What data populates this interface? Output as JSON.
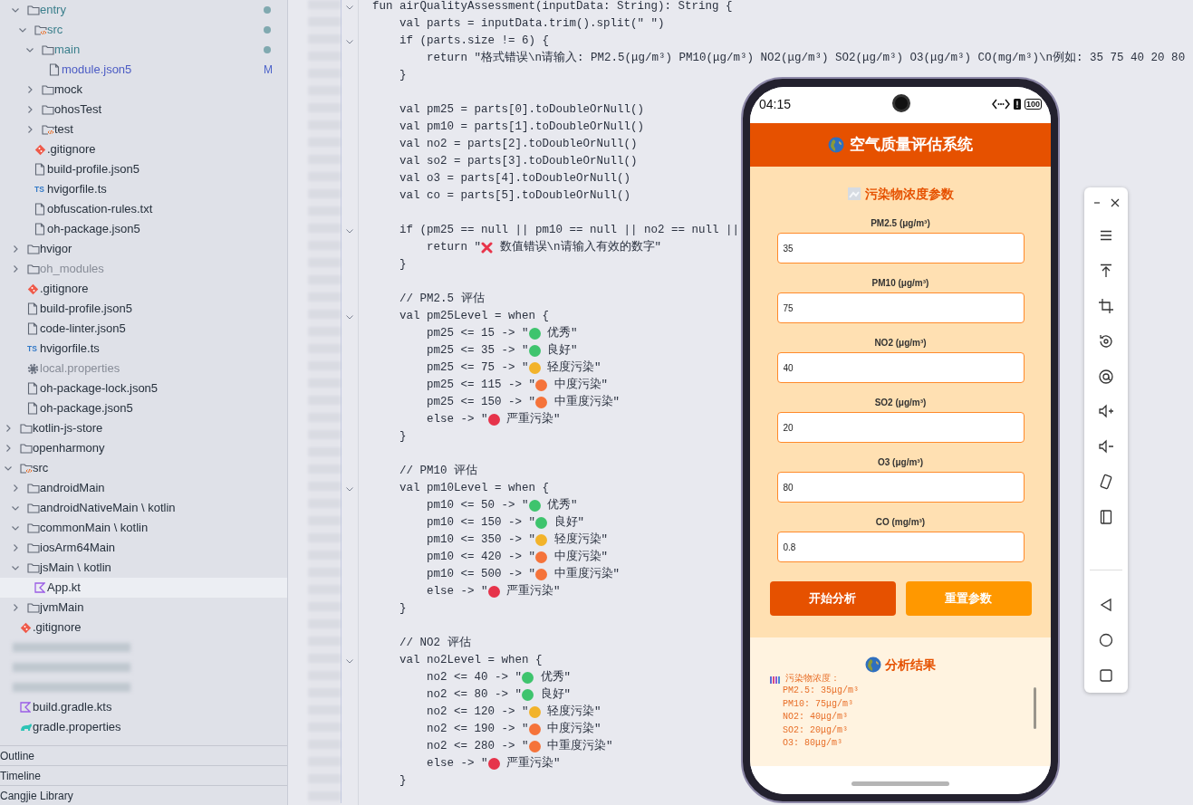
{
  "sidebar": {
    "tree": [
      {
        "children": [
          {
            "label": "entry",
            "kind": "folder",
            "expanded": true,
            "selected": false,
            "color": "#3b7f8c",
            "changed": true,
            "children": [
              {
                "label": "src",
                "kind": "source-folder",
                "expanded": true,
                "selected": false,
                "color": "#3b7f8c",
                "changed": true,
                "children": [
                  {
                    "label": "main",
                    "kind": "folder",
                    "expanded": true,
                    "selected": false,
                    "color": "#3b7f8c",
                    "changed": true,
                    "children": [
                      {
                        "label": "module.json5",
                        "kind": "file",
                        "selected": false,
                        "color": "#4b5bc4",
                        "badge": "M"
                      }
                    ]
                  },
                  {
                    "label": "mock",
                    "kind": "folder",
                    "expanded": false,
                    "selected": false
                  },
                  {
                    "label": "ohosTest",
                    "kind": "folder",
                    "expanded": false,
                    "selected": false
                  },
                  {
                    "label": "test",
                    "kind": "source-folder",
                    "expanded": false,
                    "selected": false
                  }
                ]
              },
              {
                "label": ".gitignore",
                "kind": "git",
                "selected": false
              },
              {
                "label": "build-profile.json5",
                "kind": "file",
                "selected": false
              },
              {
                "label": "hvigorfile.ts",
                "kind": "typescript",
                "icon_text": "TS",
                "selected": false
              },
              {
                "label": "obfuscation-rules.txt",
                "kind": "file",
                "selected": false
              },
              {
                "label": "oh-package.json5",
                "kind": "file",
                "selected": false
              }
            ]
          },
          {
            "label": "hvigor",
            "kind": "folder",
            "expanded": false,
            "selected": false
          },
          {
            "label": "oh_modules",
            "kind": "folder",
            "expanded": false,
            "selected": false,
            "color": "#878c97"
          },
          {
            "label": ".gitignore",
            "kind": "git",
            "selected": false
          },
          {
            "label": "build-profile.json5",
            "kind": "file",
            "selected": false
          },
          {
            "label": "code-linter.json5",
            "kind": "file",
            "selected": false
          },
          {
            "label": "hvigorfile.ts",
            "kind": "typescript",
            "icon_text": "TS",
            "selected": false
          },
          {
            "label": "local.properties",
            "kind": "gear",
            "selected": false,
            "color": "#878c97"
          },
          {
            "label": "oh-package-lock.json5",
            "kind": "file",
            "selected": false
          },
          {
            "label": "oh-package.json5",
            "kind": "file",
            "selected": false
          }
        ]
      },
      {
        "label": "kotlin-js-store",
        "kind": "folder",
        "expanded": false,
        "selected": false
      },
      {
        "label": "openharmony",
        "kind": "folder",
        "expanded": false,
        "selected": false
      },
      {
        "label": "src",
        "kind": "source-folder",
        "expanded": true,
        "selected": false,
        "children": [
          {
            "label": "androidMain",
            "kind": "folder",
            "expanded": false,
            "selected": false
          },
          {
            "label": "androidNativeMain \\ kotlin",
            "kind": "folder",
            "expanded": true,
            "selected": false
          },
          {
            "label": "commonMain \\ kotlin",
            "kind": "folder",
            "expanded": true,
            "selected": false
          },
          {
            "label": "iosArm64Main",
            "kind": "folder",
            "expanded": false,
            "selected": false
          },
          {
            "label": "jsMain \\ kotlin",
            "kind": "folder",
            "expanded": true,
            "selected": false,
            "children": [
              {
                "label": "App.kt",
                "kind": "kotlin",
                "selected": true
              }
            ]
          },
          {
            "label": "jvmMain",
            "kind": "folder",
            "expanded": false,
            "selected": false
          }
        ]
      },
      {
        "label": ".gitignore",
        "kind": "git",
        "selected": false
      },
      {
        "kind": "blurred"
      },
      {
        "kind": "blurred"
      },
      {
        "kind": "blurred"
      },
      {
        "label": "build.gradle.kts",
        "kind": "kotlin",
        "selected": false
      },
      {
        "label": "gradle.properties",
        "kind": "gradle",
        "selected": false
      }
    ],
    "panels": [
      "Outline",
      "Timeline",
      "Cangjie Library"
    ]
  },
  "code": {
    "lines": [
      {
        "kind": "code",
        "fold": true,
        "text": "fun airQualityAssessment(inputData: String): String {"
      },
      {
        "kind": "code",
        "fold": false,
        "text": "    val parts = inputData.trim().split(\" \")"
      },
      {
        "kind": "code",
        "fold": true,
        "text": "    if (parts.size != 6) {"
      },
      {
        "kind": "code",
        "fold": false,
        "text": "        return \"格式错误\\n请输入: PM2.5(μg/m³) PM10(μg/m³) NO2(μg/m³) SO2(μg/m³) O3(μg/m³) CO(mg/m³)\\n例如: 35 75 40 20 80"
      },
      {
        "kind": "code",
        "fold": false,
        "text": "    }"
      },
      {
        "kind": "blank"
      },
      {
        "kind": "code",
        "fold": false,
        "text": "    val pm25 = parts[0].toDoubleOrNull()"
      },
      {
        "kind": "code",
        "fold": false,
        "text": "    val pm10 = parts[1].toDoubleOrNull()"
      },
      {
        "kind": "code",
        "fold": false,
        "text": "    val no2 = parts[2].toDoubleOrNull()"
      },
      {
        "kind": "code",
        "fold": false,
        "text": "    val so2 = parts[3].toDoubleOrNull()"
      },
      {
        "kind": "code",
        "fold": false,
        "text": "    val o3 = parts[4].toDoubleOrNull()"
      },
      {
        "kind": "code",
        "fold": false,
        "text": "    val co = parts[5].toDoubleOrNull()"
      },
      {
        "kind": "blank"
      },
      {
        "kind": "code",
        "fold": true,
        "text": "    if (pm25 == null || pm10 == null || no2 == null ||"
      },
      {
        "kind": "code",
        "fold": false,
        "text": "        return \"",
        "icon": {
          "kind": "cross"
        },
        "after": " 数值错误\\n请输入有效的数字\""
      },
      {
        "kind": "code",
        "fold": false,
        "text": "    }"
      },
      {
        "kind": "blank"
      },
      {
        "kind": "code",
        "fold": false,
        "text": "    // PM2.5 评估"
      },
      {
        "kind": "code",
        "fold": true,
        "text": "    val pm25Level = when {"
      },
      {
        "kind": "code",
        "fold": false,
        "text": "        pm25 <= 15 -> \"",
        "icon": {
          "kind": "dot",
          "color": "#3ec46d"
        },
        "after": " 优秀\""
      },
      {
        "kind": "code",
        "fold": false,
        "text": "        pm25 <= 35 -> \"",
        "icon": {
          "kind": "dot",
          "color": "#3ec46d"
        },
        "after": " 良好\""
      },
      {
        "kind": "code",
        "fold": false,
        "text": "        pm25 <= 75 -> \"",
        "icon": {
          "kind": "dot",
          "color": "#f2b32a"
        },
        "after": " 轻度污染\""
      },
      {
        "kind": "code",
        "fold": false,
        "text": "        pm25 <= 115 -> \"",
        "icon": {
          "kind": "dot",
          "color": "#f5733a"
        },
        "after": " 中度污染\""
      },
      {
        "kind": "code",
        "fold": false,
        "text": "        pm25 <= 150 -> \"",
        "icon": {
          "kind": "dot",
          "color": "#f5733a"
        },
        "after": " 中重度污染\""
      },
      {
        "kind": "code",
        "fold": false,
        "text": "        else -> \"",
        "icon": {
          "kind": "dot",
          "color": "#e6334a"
        },
        "after": " 严重污染\""
      },
      {
        "kind": "code",
        "fold": false,
        "text": "    }"
      },
      {
        "kind": "blank"
      },
      {
        "kind": "code",
        "fold": false,
        "text": "    // PM10 评估"
      },
      {
        "kind": "code",
        "fold": true,
        "text": "    val pm10Level = when {"
      },
      {
        "kind": "code",
        "fold": false,
        "text": "        pm10 <= 50 -> \"",
        "icon": {
          "kind": "dot",
          "color": "#3ec46d"
        },
        "after": " 优秀\""
      },
      {
        "kind": "code",
        "fold": false,
        "text": "        pm10 <= 150 -> \"",
        "icon": {
          "kind": "dot",
          "color": "#3ec46d"
        },
        "after": " 良好\""
      },
      {
        "kind": "code",
        "fold": false,
        "text": "        pm10 <= 350 -> \"",
        "icon": {
          "kind": "dot",
          "color": "#f2b32a"
        },
        "after": " 轻度污染\""
      },
      {
        "kind": "code",
        "fold": false,
        "text": "        pm10 <= 420 -> \"",
        "icon": {
          "kind": "dot",
          "color": "#f5733a"
        },
        "after": " 中度污染\""
      },
      {
        "kind": "code",
        "fold": false,
        "text": "        pm10 <= 500 -> \"",
        "icon": {
          "kind": "dot",
          "color": "#f5733a"
        },
        "after": " 中重度污染\""
      },
      {
        "kind": "code",
        "fold": false,
        "text": "        else -> \"",
        "icon": {
          "kind": "dot",
          "color": "#e6334a"
        },
        "after": " 严重污染\""
      },
      {
        "kind": "code",
        "fold": false,
        "text": "    }"
      },
      {
        "kind": "blank"
      },
      {
        "kind": "code",
        "fold": false,
        "text": "    // NO2 评估"
      },
      {
        "kind": "code",
        "fold": true,
        "text": "    val no2Level = when {"
      },
      {
        "kind": "code",
        "fold": false,
        "text": "        no2 <= 40 -> \"",
        "icon": {
          "kind": "dot",
          "color": "#3ec46d"
        },
        "after": " 优秀\""
      },
      {
        "kind": "code",
        "fold": false,
        "text": "        no2 <= 80 -> \"",
        "icon": {
          "kind": "dot",
          "color": "#3ec46d"
        },
        "after": " 良好\""
      },
      {
        "kind": "code",
        "fold": false,
        "text": "        no2 <= 120 -> \"",
        "icon": {
          "kind": "dot",
          "color": "#f2b32a"
        },
        "after": " 轻度污染\""
      },
      {
        "kind": "code",
        "fold": false,
        "text": "        no2 <= 190 -> \"",
        "icon": {
          "kind": "dot",
          "color": "#f5733a"
        },
        "after": " 中度污染\""
      },
      {
        "kind": "code",
        "fold": false,
        "text": "        no2 <= 280 -> \"",
        "icon": {
          "kind": "dot",
          "color": "#f5733a"
        },
        "after": " 中重度污染\""
      },
      {
        "kind": "code",
        "fold": false,
        "text": "        else -> \"",
        "icon": {
          "kind": "dot",
          "color": "#e6334a"
        },
        "after": " 严重污染\""
      },
      {
        "kind": "code",
        "fold": false,
        "text": "    }"
      }
    ]
  },
  "phone": {
    "status_bar": {
      "time": "04:15",
      "battery": "100"
    },
    "app": {
      "title": "空气质量评估系统",
      "section_title": "污染物浓度参数",
      "fields": [
        {
          "label": "PM2.5 (μg/m³)",
          "value": "35"
        },
        {
          "label": "PM10 (μg/m³)",
          "value": "75"
        },
        {
          "label": "NO2 (μg/m³)",
          "value": "40"
        },
        {
          "label": "SO2 (μg/m³)",
          "value": "20"
        },
        {
          "label": "O3 (μg/m³)",
          "value": "80"
        },
        {
          "label": "CO (mg/m³)",
          "value": "0.8"
        }
      ],
      "buttons": [
        {
          "label": "开始分析",
          "kind": "primary"
        },
        {
          "label": "重置参数",
          "kind": "secondary"
        }
      ],
      "result": {
        "title": "分析结果",
        "heading": "污染物浓度：",
        "lines": [
          "PM2.5: 35μg/m³",
          "PM10: 75μg/m³",
          "NO2: 40μg/m³",
          "SO2: 20μg/m³",
          "O3: 80μg/m³"
        ]
      }
    }
  }
}
